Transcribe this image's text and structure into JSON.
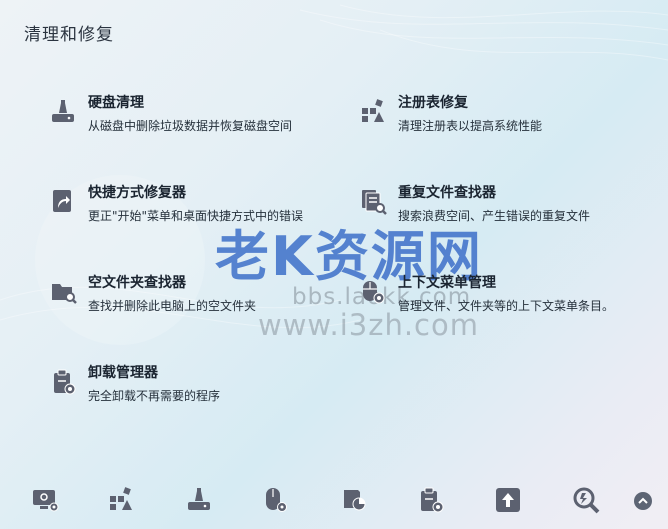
{
  "page": {
    "title": "清理和修复"
  },
  "tools": [
    {
      "name": "硬盘清理",
      "desc": "从磁盘中删除垃圾数据并恢复磁盘空间",
      "icon": "disk-clean-icon"
    },
    {
      "name": "注册表修复",
      "desc": "清理注册表以提高系统性能",
      "icon": "registry-icon"
    },
    {
      "name": "快捷方式修复器",
      "desc": "更正\"开始\"菜单和桌面快捷方式中的错误",
      "icon": "shortcut-fix-icon"
    },
    {
      "name": "重复文件查找器",
      "desc": "搜索浪费空间、产生错误的重复文件",
      "icon": "duplicate-file-icon"
    },
    {
      "name": "空文件夹查找器",
      "desc": "查找并删除此电脑上的空文件夹",
      "icon": "empty-folder-icon"
    },
    {
      "name": "上下文菜单管理",
      "desc": "管理文件、文件夹等的上下文菜单条目。",
      "icon": "context-menu-icon"
    },
    {
      "name": "卸载管理器",
      "desc": "完全卸载不再需要的程序",
      "icon": "uninstall-icon"
    }
  ],
  "watermark": {
    "main": "老K资源网",
    "sub": "bbs.laokk.com",
    "sub2": "www.i3zh.com"
  },
  "bottom_nav": [
    "monitor-gear-icon",
    "registry-icon",
    "disk-clean-icon",
    "mouse-gear-icon",
    "disk-chart-icon",
    "clipboard-gear-icon",
    "upload-icon",
    "search-zoom-icon"
  ],
  "colors": {
    "icon": "#5c6170",
    "wm": "#3c6ec8"
  }
}
